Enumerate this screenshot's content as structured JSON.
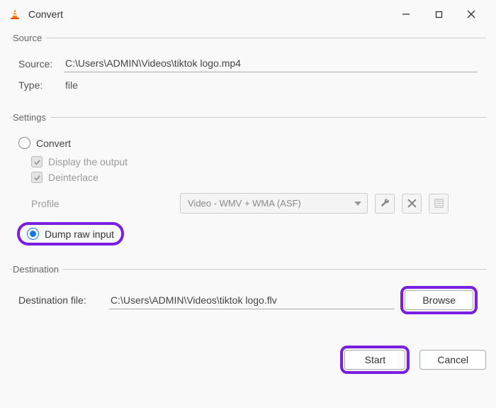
{
  "window": {
    "title": "Convert"
  },
  "source": {
    "legend": "Source",
    "source_label": "Source:",
    "source_value": "C:\\Users\\ADMIN\\Videos\\tiktok logo.mp4",
    "type_label": "Type:",
    "type_value": "file"
  },
  "settings": {
    "legend": "Settings",
    "convert_label": "Convert",
    "display_output_label": "Display the output",
    "deinterlace_label": "Deinterlace",
    "profile_label": "Profile",
    "profile_value": "Video - WMV + WMA (ASF)",
    "dump_raw_label": "Dump raw input"
  },
  "destination": {
    "legend": "Destination",
    "destfile_label": "Destination file:",
    "destfile_value": "C:\\Users\\ADMIN\\Videos\\tiktok logo.flv",
    "browse_label": "Browse"
  },
  "footer": {
    "start_label": "Start",
    "cancel_label": "Cancel"
  },
  "icons": {
    "wrench": "wrench-icon",
    "delete": "delete-icon",
    "new": "new-profile-icon"
  }
}
